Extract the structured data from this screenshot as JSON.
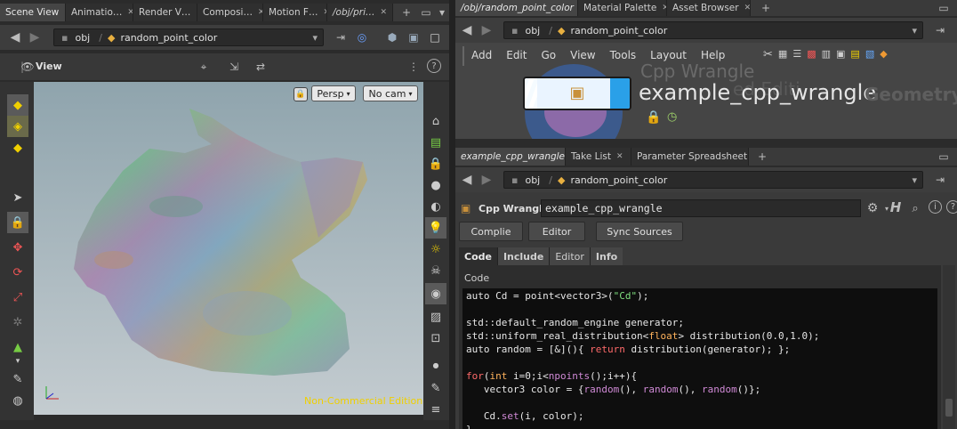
{
  "left_tabs": [
    "Scene View",
    "Animatio…",
    "Render V…",
    "Composi…",
    "Motion F…",
    "/obj/pri…"
  ],
  "right_top_tabs": [
    "/obj/random_point_color",
    "Material Palette",
    "Asset Browser"
  ],
  "right_bottom_tabs": [
    "example_cpp_wrangle",
    "Take List",
    "Parameter Spreadsheet"
  ],
  "path": {
    "root": "obj",
    "node": "random_point_color"
  },
  "viewport": {
    "title": "View",
    "persp": "Persp",
    "cam": "No cam",
    "watermark": "Non-Commercial Edition"
  },
  "menu": [
    "Add",
    "Edit",
    "Go",
    "View",
    "Tools",
    "Layout",
    "Help"
  ],
  "network": {
    "type_label": "Cpp Wrangle",
    "node_name": "example_cpp_wrangle",
    "faded_suffix": "Geometry",
    "faded_extra": "ed Editi"
  },
  "params": {
    "type_label": "Cpp Wrangle",
    "name_value": "example_cpp_wrangle",
    "buttons": [
      "Complie",
      "Editor",
      "Sync Sources"
    ],
    "subtabs": [
      "Code",
      "Include",
      "Editor",
      "Info"
    ],
    "code_label": "Code"
  },
  "code_lines": [
    [
      [
        "",
        "auto Cd = point<vector3>("
      ],
      [
        "st",
        "\"Cd\""
      ],
      [
        "",
        ");"
      ]
    ],
    [],
    [
      [
        "",
        "std::default_random_engine generator;"
      ]
    ],
    [
      [
        "",
        "std::uniform_real_distribution<"
      ],
      [
        "ty",
        "float"
      ],
      [
        "",
        "> distribution(0.0,1.0);"
      ]
    ],
    [
      [
        "",
        "auto random = [&](){ "
      ],
      [
        "kw",
        "return"
      ],
      [
        "",
        " distribution(generator); };"
      ]
    ],
    [],
    [
      [
        "kw",
        "for"
      ],
      [
        "",
        "("
      ],
      [
        "ty",
        "int"
      ],
      [
        "",
        " i=0;i<"
      ],
      [
        "fn",
        "npoints"
      ],
      [
        "",
        "();i++){"
      ]
    ],
    [
      [
        "",
        "   vector3 color = {"
      ],
      [
        "fn",
        "random"
      ],
      [
        "",
        "(), "
      ],
      [
        "fn",
        "random"
      ],
      [
        "",
        "(), "
      ],
      [
        "fn",
        "random"
      ],
      [
        "",
        "()};"
      ]
    ],
    [],
    [
      [
        "",
        "   Cd."
      ],
      [
        "fn",
        "set"
      ],
      [
        "",
        "(i, color);"
      ]
    ],
    [
      [
        "",
        "}"
      ]
    ]
  ],
  "colors": {
    "accent": "#f0d000",
    "panel": "#3a3a3a",
    "code_bg": "#0e0e0e",
    "viewport_top": "#8fa4ad",
    "viewport_bottom": "#c4ccd0"
  }
}
